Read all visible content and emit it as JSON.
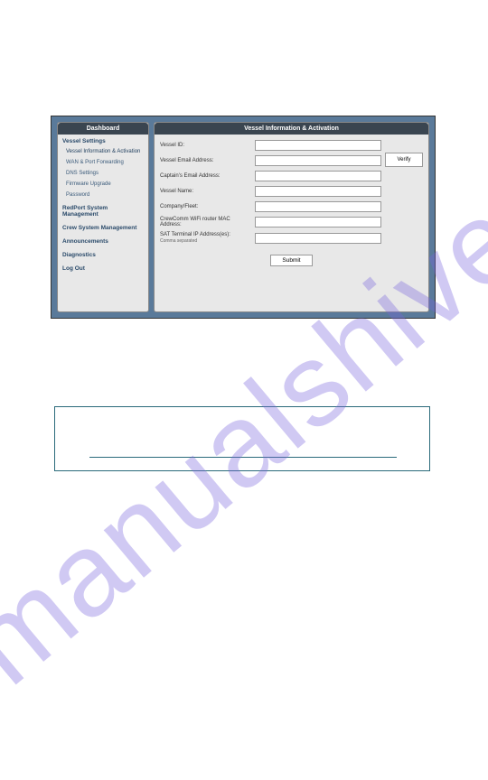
{
  "watermark": "manualshive.com",
  "sidebar": {
    "header": "Dashboard",
    "sections": {
      "vessel_settings": "Vessel Settings",
      "items": [
        "Vessel Information & Activation",
        "WAN & Port Forwarding",
        "DNS Settings",
        "Firmware Upgrade",
        "Password"
      ],
      "redport": "RedPort System Management",
      "crew": "Crew System Management",
      "announcements": "Announcements",
      "diagnostics": "Diagnostics",
      "logout": "Log Out"
    }
  },
  "main": {
    "header": "Vessel Information & Activation",
    "fields": {
      "vessel_id": "Vessel ID:",
      "vessel_email": "Vessel Email Address:",
      "captain_email": "Captain's Email Address:",
      "vessel_name": "Vessel Name:",
      "company_fleet": "Company/Fleet:",
      "mac_address": "CrewComm WiFi router MAC Address:",
      "sat_ip": "SAT Terminal IP Address(es):",
      "sat_ip_hint": "Comma separated"
    },
    "verify_btn": "Verify",
    "submit_btn": "Submit"
  }
}
